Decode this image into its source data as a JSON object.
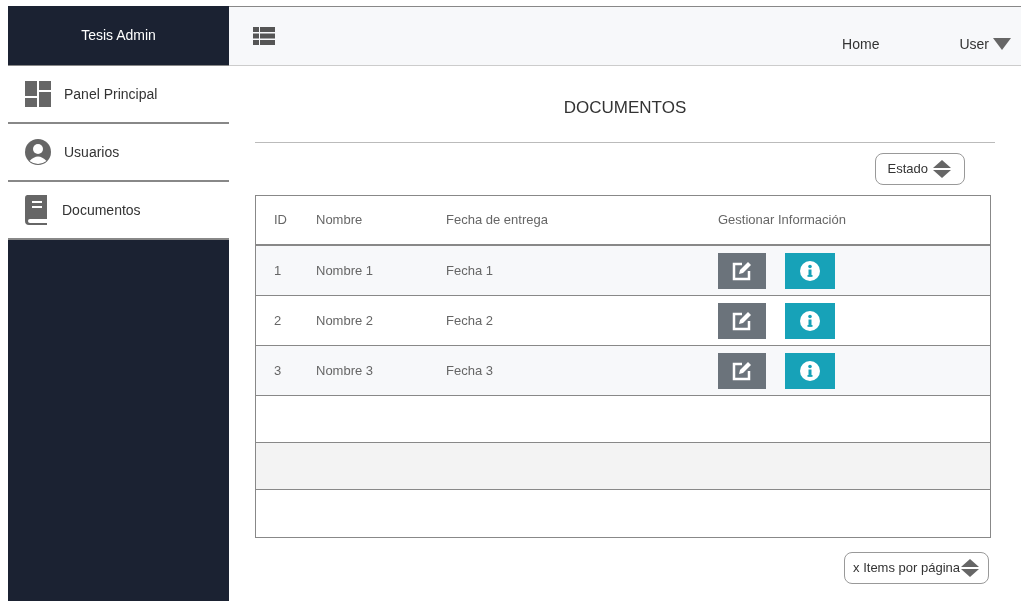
{
  "sidebar": {
    "title": "Tesis Admin",
    "items": [
      {
        "label": "Panel Principal",
        "kind": "dashboard"
      },
      {
        "label": "Usuarios",
        "kind": "user"
      },
      {
        "label": "Documentos",
        "kind": "book"
      }
    ]
  },
  "topbar": {
    "links": [
      "Home"
    ],
    "user_menu": "User"
  },
  "page_title": "DOCUMENTOS",
  "filter": {
    "label": "Estado"
  },
  "table": {
    "columns": [
      "ID",
      "Nombre",
      "Fecha de entrega",
      "Gestionar Información"
    ],
    "rows": [
      {
        "id": "1",
        "name": "Nombre 1",
        "date": "Fecha 1"
      },
      {
        "id": "2",
        "name": "Nombre 2",
        "date": "Fecha 2"
      },
      {
        "id": "3",
        "name": "Nombre 3",
        "date": "Fecha 3"
      }
    ]
  },
  "pagination": {
    "label": "x Items por página"
  }
}
